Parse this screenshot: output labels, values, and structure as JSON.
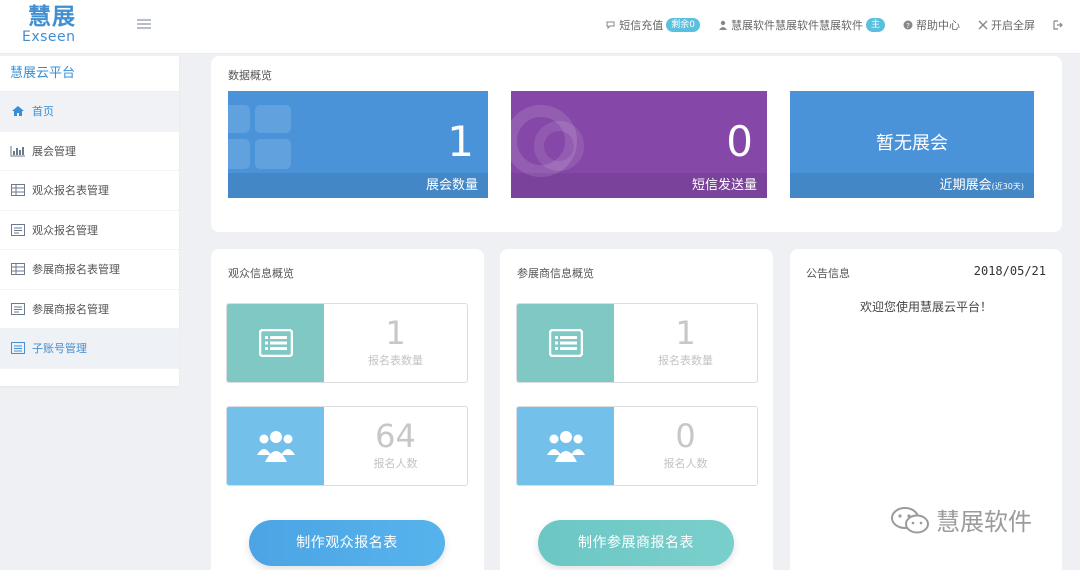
{
  "header": {
    "logo_cn": "慧展",
    "logo_en": "Exseen",
    "sms_recharge": "短信充值",
    "sms_remaining": "剩余0",
    "user_name": "慧展软件慧展软件慧展软件",
    "user_role": "主",
    "help_center": "帮助中心",
    "fullscreen": "开启全屏"
  },
  "sidebar": {
    "title": "慧展云平台",
    "items": [
      {
        "label": "首页",
        "icon": "home-icon"
      },
      {
        "label": "展会管理",
        "icon": "bar-chart-icon"
      },
      {
        "label": "观众报名表管理",
        "icon": "table-icon"
      },
      {
        "label": "观众报名管理",
        "icon": "list-icon"
      },
      {
        "label": "参展商报名表管理",
        "icon": "table-icon"
      },
      {
        "label": "参展商报名管理",
        "icon": "list-icon"
      },
      {
        "label": "子账号管理",
        "icon": "user-list-icon"
      }
    ]
  },
  "overview": {
    "title": "数据概览",
    "cards": [
      {
        "value": "1",
        "label": "展会数量",
        "color": "#4a93d8"
      },
      {
        "value": "0",
        "label": "短信发送量",
        "color": "#8548a8"
      },
      {
        "value": "暂无展会",
        "label": "近期展会",
        "sublabel": "(近30天)",
        "color": "#4a93d8"
      }
    ]
  },
  "audience": {
    "title": "观众信息概览",
    "forms_value": "1",
    "forms_label": "报名表数量",
    "people_value": "64",
    "people_label": "报名人数",
    "button": "制作观众报名表"
  },
  "exhibitor": {
    "title": "参展商信息概览",
    "forms_value": "1",
    "forms_label": "报名表数量",
    "people_value": "0",
    "people_label": "报名人数",
    "button": "制作参展商报名表"
  },
  "notice": {
    "title": "公告信息",
    "date": "2018/05/21",
    "message": "欢迎您使用慧展云平台！"
  },
  "watermark": "慧展软件",
  "colors": {
    "primary": "#4a93d8",
    "purple": "#8548a8",
    "teal": "#7fc8c4",
    "sky": "#73c1ea"
  }
}
